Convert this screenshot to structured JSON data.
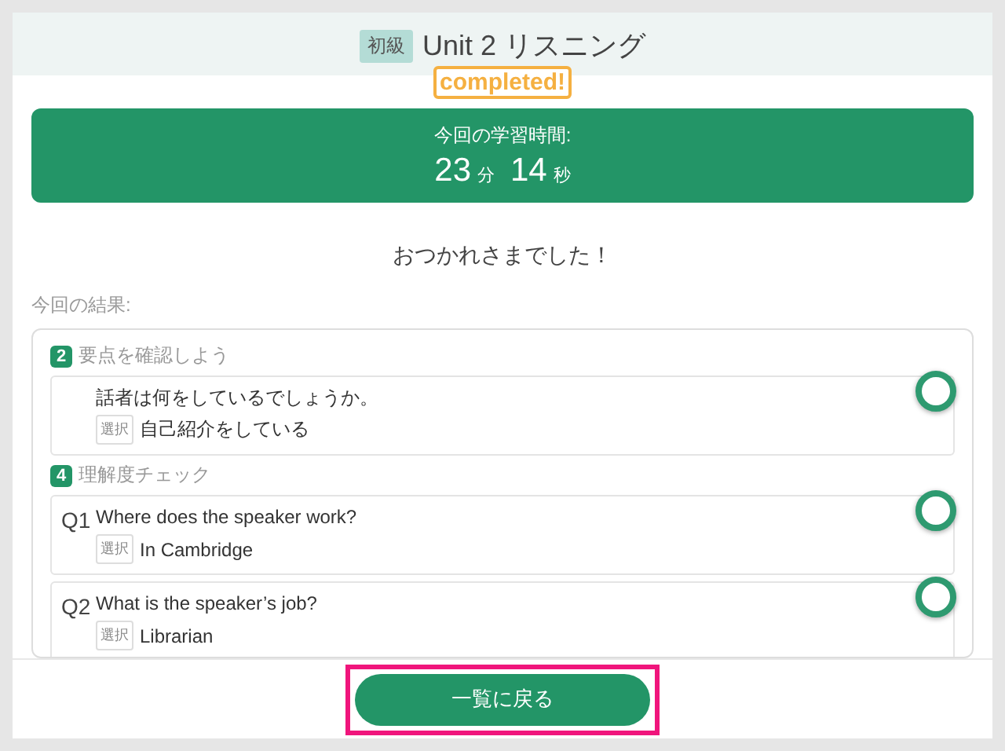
{
  "header": {
    "level_badge": "初級",
    "title": "Unit 2 リスニング",
    "status": "completed!"
  },
  "study_time": {
    "label": "今回の学習時間:",
    "minutes": "23",
    "minutes_unit": "分",
    "seconds": "14",
    "seconds_unit": "秒"
  },
  "message": "おつかれさまでした！",
  "results_label": "今回の結果:",
  "sections": [
    {
      "number": "2",
      "title": "要点を確認しよう",
      "items": [
        {
          "question": "話者は何をしているでしょうか。",
          "answer_tag": "選択",
          "answer": "自己紹介をしている",
          "correct": true
        }
      ]
    },
    {
      "number": "4",
      "title": "理解度チェック",
      "items": [
        {
          "prefix": "Q1",
          "question": "Where does the speaker work?",
          "answer_tag": "選択",
          "answer": "In Cambridge",
          "correct": true
        },
        {
          "prefix": "Q2",
          "question": "What is the speaker’s job?",
          "answer_tag": "選択",
          "answer": "Librarian",
          "correct": true
        }
      ]
    }
  ],
  "back_button": {
    "label": "一覧に戻る",
    "highlighted": true
  }
}
